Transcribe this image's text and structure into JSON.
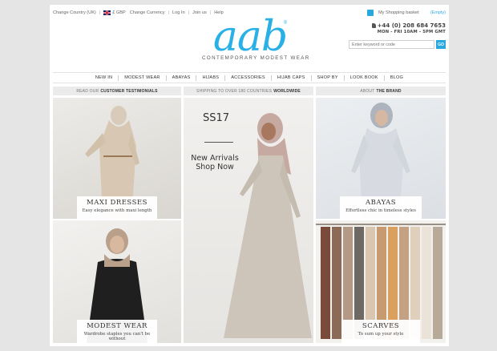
{
  "topbar": {
    "country": "Change Country (UK)",
    "currency_code": "£ GBP",
    "change_currency": "Change Currency",
    "login": "Log In",
    "join": "Join us",
    "help": "Help"
  },
  "basket": {
    "label": "My Shopping basket",
    "status": "(Empty)"
  },
  "contact": {
    "phone": "+44 (0) 208 684 7653",
    "hours": "MON - FRI 10AM - 5PM GMT"
  },
  "search": {
    "placeholder": "Enter keyword or code",
    "button": "GO"
  },
  "logo": {
    "mark": "aab",
    "registered": "®",
    "tagline": "CONTEMPORARY MODEST WEAR"
  },
  "nav": [
    "NEW IN",
    "MODEST WEAR",
    "ABAYAS",
    "HIJABS",
    "ACCESSORIES",
    "HIJAB CAPS",
    "SHOP BY",
    "LOOK BOOK",
    "BLOG"
  ],
  "strips": [
    {
      "prefix": "READ OUR",
      "bold": "CUSTOMER TESTIMONIALS"
    },
    {
      "prefix": "SHIPPING TO OVER 180 COUNTRIES",
      "bold": "WORLDWIDE"
    },
    {
      "prefix": "ABOUT",
      "bold": "THE BRAND"
    }
  ],
  "tiles": {
    "maxi": {
      "title": "MAXI DRESSES",
      "subtitle": "Easy elegance with maxi length"
    },
    "modest": {
      "title": "MODEST WEAR",
      "subtitle": "Wardrobe staples you can't be without"
    },
    "abayas": {
      "title": "ABAYAS",
      "subtitle": "Effortless chic in timeless styles"
    },
    "scarves": {
      "title": "SCARVES",
      "subtitle": "To sum up your style"
    },
    "hero": {
      "season": "SS17",
      "line1": "New Arrivals",
      "line2": "Shop Now"
    }
  },
  "colors": {
    "brand": "#29b0e6",
    "strip": "#ebebeb"
  }
}
